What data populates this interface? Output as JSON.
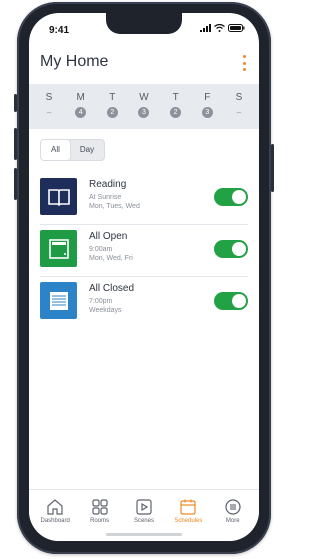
{
  "status": {
    "time": "9:41"
  },
  "header": {
    "title": "My Home"
  },
  "days": [
    {
      "letter": "S",
      "count": ""
    },
    {
      "letter": "M",
      "count": "4"
    },
    {
      "letter": "T",
      "count": "2"
    },
    {
      "letter": "W",
      "count": "3"
    },
    {
      "letter": "T",
      "count": "2"
    },
    {
      "letter": "F",
      "count": "3"
    },
    {
      "letter": "S",
      "count": ""
    }
  ],
  "filter": {
    "all": "All",
    "day": "Day"
  },
  "schedules": [
    {
      "title": "Reading",
      "line1": "At Sunrise",
      "line2": "Mon, Tues, Wed",
      "icon": "book-icon",
      "color": "#1e2d5a"
    },
    {
      "title": "All Open",
      "line1": "9:00am",
      "line2": "Mon, Wed, Fri",
      "icon": "shade-open-icon",
      "color": "#1f9a45"
    },
    {
      "title": "All Closed",
      "line1": "7:00pm",
      "line2": "Weekdays",
      "icon": "shade-closed-icon",
      "color": "#2d83c7"
    }
  ],
  "tabs": [
    {
      "label": "Dashboard",
      "icon": "home-icon"
    },
    {
      "label": "Rooms",
      "icon": "rooms-icon"
    },
    {
      "label": "Scenes",
      "icon": "scenes-icon"
    },
    {
      "label": "Schedules",
      "icon": "schedules-icon"
    },
    {
      "label": "More",
      "icon": "more-icon"
    }
  ],
  "colors": {
    "accent": "#f08a24",
    "toggle_on": "#22a244"
  }
}
